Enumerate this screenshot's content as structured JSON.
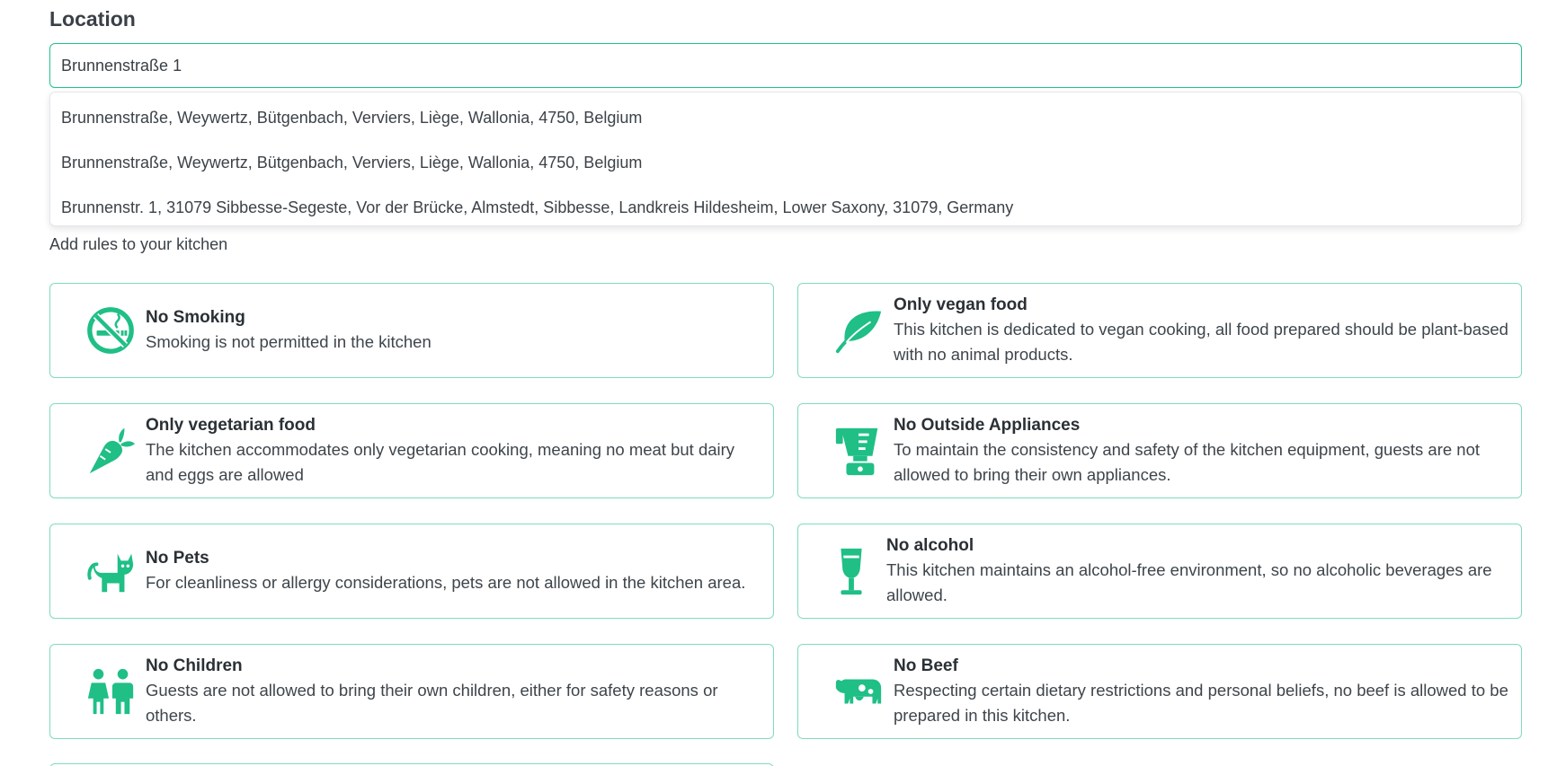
{
  "location": {
    "title": "Location",
    "input_value": "Brunnenstraße 1",
    "suggestions": [
      "Brunnenstraße, Weywertz, Bütgenbach, Verviers, Liège, Wallonia, 4750, Belgium",
      "Brunnenstraße, Weywertz, Bütgenbach, Verviers, Liège, Wallonia, 4750, Belgium",
      "Brunnenstr. 1, 31079 Sibbesse-Segeste, Vor der Brücke, Almstedt, Sibbesse, Landkreis Hildesheim, Lower Saxony, 31079, Germany"
    ]
  },
  "rules": {
    "label": "Add rules to your kitchen",
    "accent_color": "#1fbf86",
    "items": [
      {
        "icon": "no-smoking-icon",
        "title": "No Smoking",
        "desc": "Smoking is not permitted in the kitchen"
      },
      {
        "icon": "leaf-icon",
        "title": "Only vegan food",
        "desc": "This kitchen is dedicated to vegan cooking, all food prepared should be plant-based with no animal products."
      },
      {
        "icon": "carrot-icon",
        "title": "Only vegetarian food",
        "desc": "The kitchen accommodates only vegetarian cooking, meaning no meat but dairy and eggs are allowed"
      },
      {
        "icon": "blender-icon",
        "title": "No Outside Appliances",
        "desc": "To maintain the consistency and safety of the kitchen equipment, guests are not allowed to bring their own appliances."
      },
      {
        "icon": "cat-icon",
        "title": "No Pets",
        "desc": "For cleanliness or allergy considerations, pets are not allowed in the kitchen area."
      },
      {
        "icon": "wine-glass-icon",
        "title": "No alcohol",
        "desc": "This kitchen maintains an alcohol-free environment, so no alcoholic beverages are allowed."
      },
      {
        "icon": "children-icon",
        "title": "No Children",
        "desc": "Guests are not allowed to bring their own children, either for safety reasons or others."
      },
      {
        "icon": "cow-icon",
        "title": "No Beef",
        "desc": "Respecting certain dietary restrictions and personal beliefs, no beef is allowed to be prepared in this kitchen."
      }
    ]
  }
}
